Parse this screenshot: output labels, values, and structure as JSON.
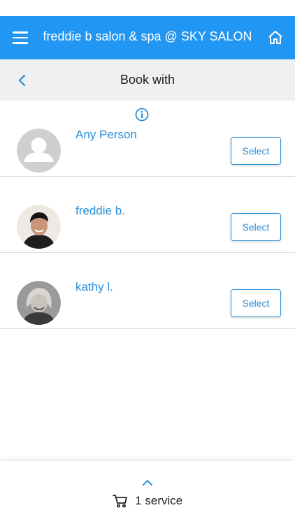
{
  "app_bar": {
    "title": "freddie b salon & spa @ SKY SALON",
    "color": "#2196f3",
    "menu_icon": "hamburger-icon",
    "home_icon": "home-icon"
  },
  "sub_header": {
    "title": "Book with",
    "back_icon": "chevron-left-icon"
  },
  "staff": [
    {
      "name": "Any Person",
      "select_label": "Select",
      "avatar": "placeholder-avatar",
      "has_info": false
    },
    {
      "name": "freddie b.",
      "select_label": "Select",
      "avatar": "photo-avatar",
      "has_info": true
    },
    {
      "name": "kathy l.",
      "select_label": "Select",
      "avatar": "photo-avatar",
      "has_info": false
    }
  ],
  "bottom_bar": {
    "cart_label": "1 service",
    "cart_icon": "cart-icon",
    "expand_icon": "chevron-up-icon"
  },
  "colors": {
    "accent": "#2a8fd9",
    "divider": "#dcdcdc",
    "sub_bar_bg": "#f0f0f0"
  }
}
